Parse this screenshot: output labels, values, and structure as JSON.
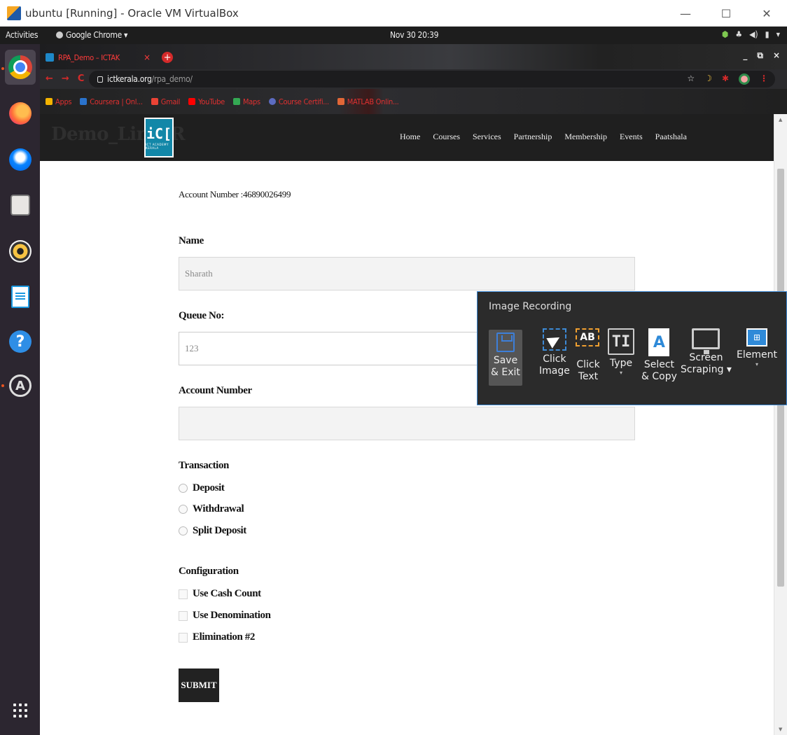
{
  "vbox": {
    "title": "ubuntu [Running] - Oracle VM VirtualBox",
    "minimize": "—",
    "maximize": "☐",
    "close": "✕"
  },
  "topbar": {
    "activities": "Activities",
    "app_menu": "Google Chrome ▾",
    "clock": "Nov 30  20:39",
    "tray": [
      "⬢",
      "♣",
      "◀)",
      "▮",
      "▾"
    ]
  },
  "chrome": {
    "tab_title": "RPA_Demo – ICTAK",
    "tab_close": "×",
    "new_tab": "+",
    "window_controls": [
      "_",
      "⧉",
      "×"
    ],
    "nav": [
      "←",
      "→",
      "C"
    ],
    "url_host": "ictkerala.org",
    "url_path": "/rpa_demo/",
    "star": "☆",
    "moon": "☽",
    "ext": "✱",
    "menu": "⋮",
    "bookmarks": [
      {
        "label": "Apps",
        "icon": "apps-grid-icon",
        "color": "#f4b400"
      },
      {
        "label": "Coursera | Onl...",
        "icon": "coursera-icon",
        "color": "#2a73cc"
      },
      {
        "label": "Gmail",
        "icon": "gmail-icon",
        "color": "#ea4335"
      },
      {
        "label": "YouTube",
        "icon": "youtube-icon",
        "color": "#ff0000"
      },
      {
        "label": "Maps",
        "icon": "maps-icon",
        "color": "#34a853"
      },
      {
        "label": "Course Certifi...",
        "icon": "pearson-icon",
        "color": "#5c6bc0"
      },
      {
        "label": "MATLAB Onlin...",
        "icon": "matlab-icon",
        "color": "#e16737"
      }
    ]
  },
  "site": {
    "brand": "Demo_Link_R",
    "logo_glyph": "ǐ̲C̲T̲",
    "logo_sub": "ICT ACADEMY KERALA",
    "nav": [
      "Home",
      "Courses",
      "Services",
      "Partnership",
      "Membership",
      "Events",
      "Paatshala"
    ]
  },
  "form": {
    "account_number_text": "Account Number :46890026499",
    "name_label": "Name",
    "name_value": "Sharath",
    "queue_label": "Queue No:",
    "queue_value": "123",
    "account_label": "Account Number",
    "account_value": "",
    "transaction_label": "Transaction",
    "transaction_options": [
      "Deposit",
      "Withdrawal",
      "Split Deposit"
    ],
    "configuration_label": "Configuration",
    "configuration_options": [
      "Use Cash Count",
      "Use Denomination",
      "Elimination #2"
    ],
    "submit_label": "SUBMIT"
  },
  "recorder": {
    "title": "Image Recording",
    "buttons": [
      {
        "line1": "Save",
        "line2": "& Exit",
        "icon": "save-icon"
      },
      {
        "line1": "Click",
        "line2": "Image",
        "icon": "click-image-icon"
      },
      {
        "line1": "Click",
        "line2": "Text",
        "icon": "click-text-icon",
        "glyph": "AB"
      },
      {
        "line1": "Type",
        "line2": "▾",
        "icon": "type-icon",
        "glyph": "TI"
      },
      {
        "line1": "Select",
        "line2": "& Copy",
        "icon": "select-copy-icon",
        "glyph": "A"
      },
      {
        "line1": "Screen",
        "line2": "Scraping ▾",
        "icon": "screen-scraping-icon"
      },
      {
        "line1": "Element",
        "line2": "▾",
        "icon": "element-icon",
        "glyph": "⊞"
      }
    ]
  }
}
